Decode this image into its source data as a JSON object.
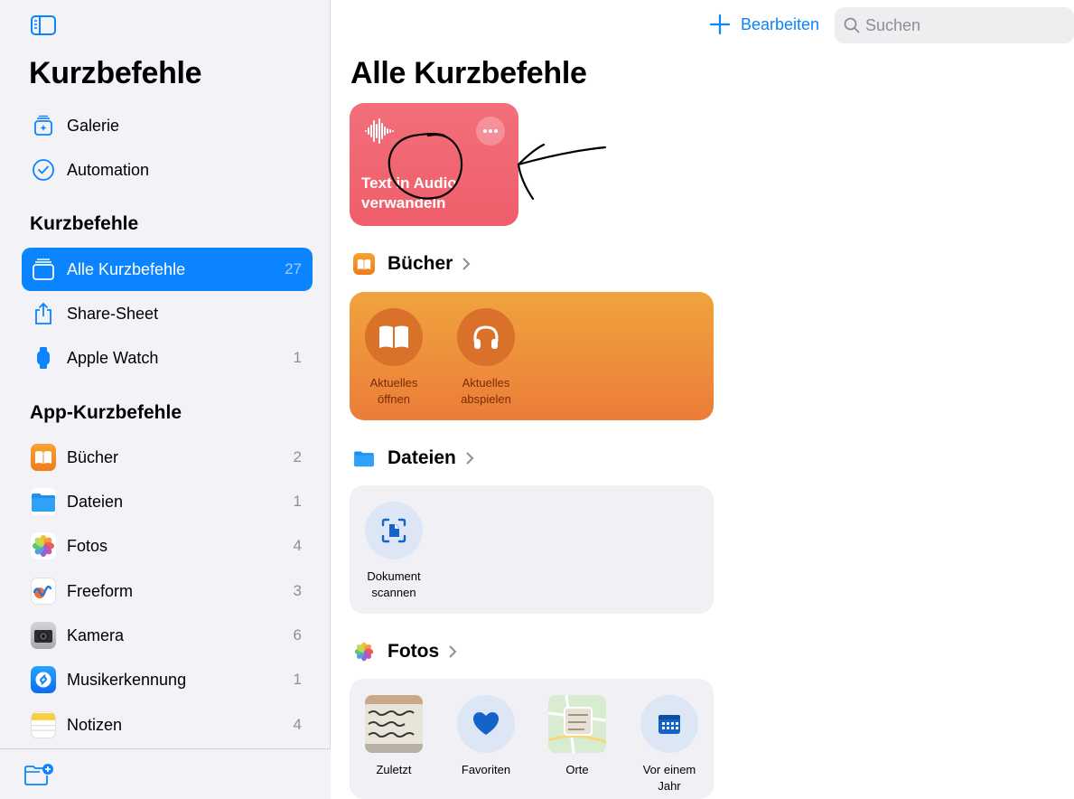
{
  "sidebar": {
    "title": "Kurzbefehle",
    "top_items": [
      {
        "label": "Galerie",
        "icon": "gallery-icon"
      },
      {
        "label": "Automation",
        "icon": "automation-clock-icon"
      }
    ],
    "section_shortcuts": "Kurzbefehle",
    "shortcut_items": [
      {
        "label": "Alle Kurzbefehle",
        "count": "27",
        "icon": "all-shortcuts-icon",
        "selected": true
      },
      {
        "label": "Share-Sheet",
        "count": "",
        "icon": "share-icon"
      },
      {
        "label": "Apple Watch",
        "count": "1",
        "icon": "watch-icon"
      }
    ],
    "section_apps": "App-Kurzbefehle",
    "app_items": [
      {
        "label": "Bücher",
        "count": "2",
        "icon": "books-app-icon"
      },
      {
        "label": "Dateien",
        "count": "1",
        "icon": "files-app-icon"
      },
      {
        "label": "Fotos",
        "count": "4",
        "icon": "photos-app-icon"
      },
      {
        "label": "Freeform",
        "count": "3",
        "icon": "freeform-app-icon"
      },
      {
        "label": "Kamera",
        "count": "6",
        "icon": "camera-app-icon"
      },
      {
        "label": "Musikerkennung",
        "count": "1",
        "icon": "shazam-app-icon"
      },
      {
        "label": "Notizen",
        "count": "4",
        "icon": "notes-app-icon"
      }
    ]
  },
  "toolbar": {
    "edit_label": "Bearbeiten",
    "search_placeholder": "Suchen"
  },
  "main": {
    "title": "Alle Kurzbefehle",
    "shortcut_tile": {
      "label_line1": "Text in Audio",
      "label_line2": "verwandeln",
      "color": "#f0636f"
    },
    "groups": {
      "books": {
        "title": "Bücher",
        "actions": [
          {
            "line1": "Aktuelles",
            "line2": "öffnen",
            "icon": "open-book-icon"
          },
          {
            "line1": "Aktuelles",
            "line2": "abspielen",
            "icon": "headphones-icon"
          }
        ]
      },
      "files": {
        "title": "Dateien",
        "actions": [
          {
            "line1": "Dokument",
            "line2": "scannen",
            "icon": "document-scan-icon"
          }
        ]
      },
      "photos": {
        "title": "Fotos",
        "actions": [
          {
            "line1": "Zuletzt",
            "line2": "",
            "icon": "recent-photo-thumbnail"
          },
          {
            "line1": "Favoriten",
            "line2": "",
            "icon": "heart-icon"
          },
          {
            "line1": "Orte",
            "line2": "",
            "icon": "map-thumbnail"
          },
          {
            "line1": "Vor einem",
            "line2": "Jahr",
            "icon": "calendar-icon"
          }
        ]
      }
    }
  },
  "colors": {
    "accent": "#0a84ff",
    "books_card_top": "#f0a33e",
    "books_card_bottom": "#ec7d38"
  }
}
